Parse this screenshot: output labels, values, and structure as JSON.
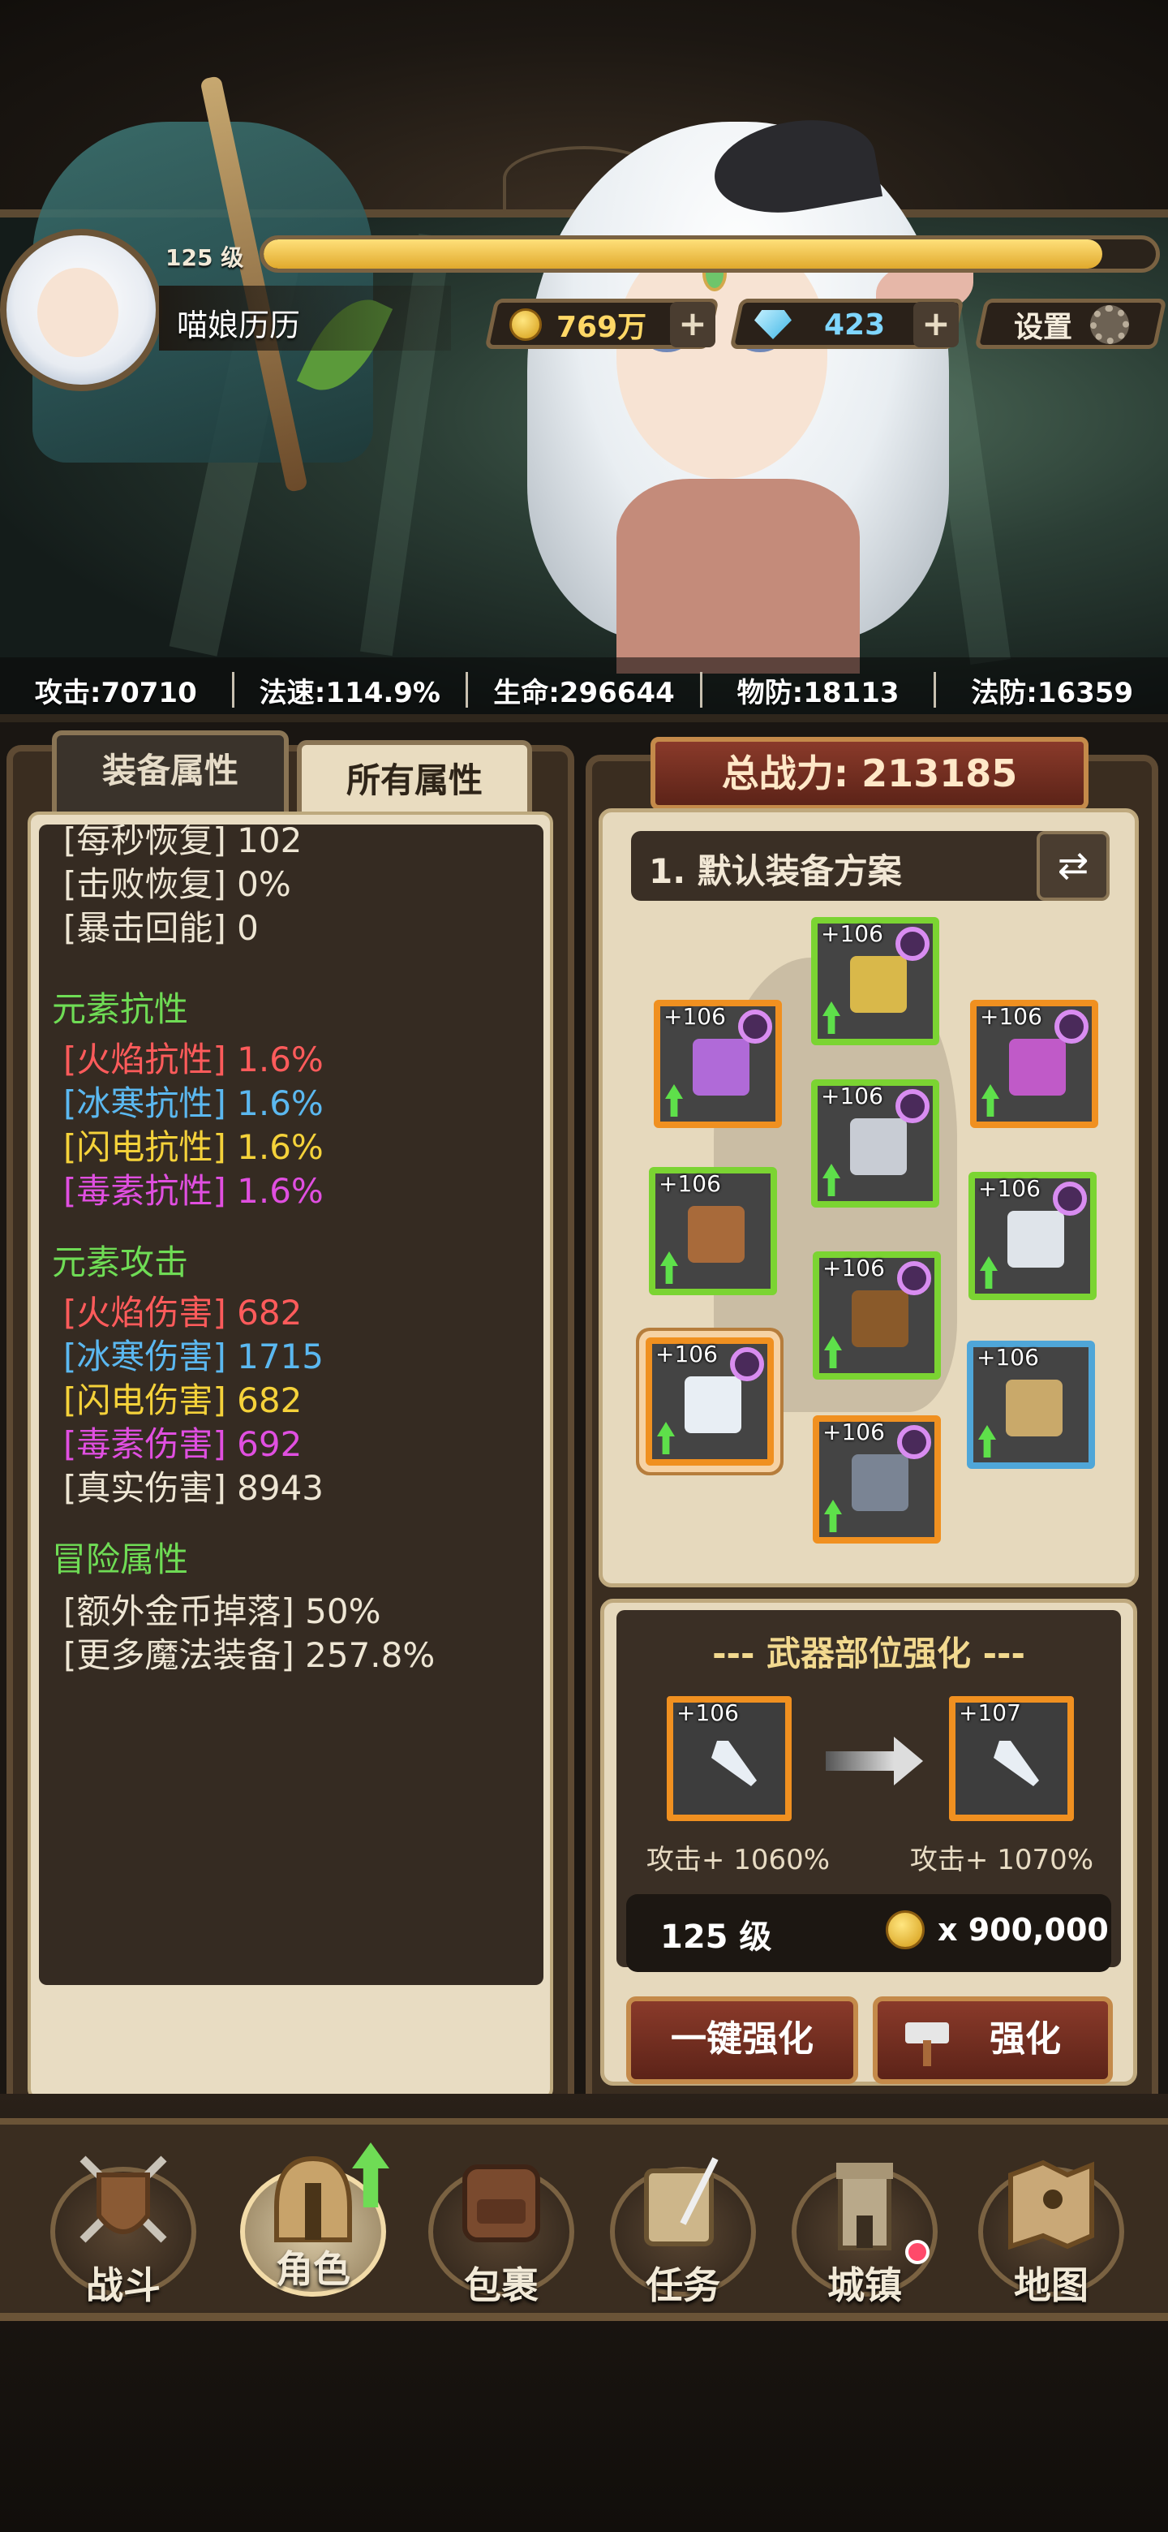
{
  "player": {
    "level_label": "125 级",
    "xp_fraction": 0.94,
    "name": "喵娘历历"
  },
  "resources": {
    "gold": "769万",
    "gems": "423",
    "settings_label": "设置",
    "plus_symbol": "+"
  },
  "stats": [
    "攻击:70710",
    "法速:114.9%",
    "生命:296644",
    "物防:18113",
    "法防:16359"
  ],
  "tabs": {
    "equipment_attrs": "装备属性",
    "all_attrs": "所有属性"
  },
  "attributes": {
    "top_lines": [
      "[每秒恢复] 102",
      "[击败恢复] 0%",
      "[暴击回能] 0"
    ],
    "elem_resist_header": "元素抗性",
    "elem_resist": [
      {
        "label": "[火焰抗性]",
        "value": "1.6%"
      },
      {
        "label": "[冰寒抗性]",
        "value": "1.6%"
      },
      {
        "label": "[闪电抗性]",
        "value": "1.6%"
      },
      {
        "label": "[毒素抗性]",
        "value": "1.6%"
      }
    ],
    "elem_attack_header": "元素攻击",
    "elem_attack": [
      {
        "label": "[火焰伤害]",
        "value": "682"
      },
      {
        "label": "[冰寒伤害]",
        "value": "1715"
      },
      {
        "label": "[闪电伤害]",
        "value": "682"
      },
      {
        "label": "[毒素伤害]",
        "value": "692"
      },
      {
        "label": "[真实伤害]",
        "value": "8943"
      }
    ],
    "adventure_header": "冒险属性",
    "adventure": [
      {
        "label": "[额外金币掉落]",
        "value": "50%"
      },
      {
        "label": "[更多魔法装备]",
        "value": "257.8%"
      }
    ]
  },
  "power": {
    "label": "总战力: 213185"
  },
  "equip_plan": {
    "title": "1. 默认装备方案",
    "swap_icon": "⇄",
    "slots": [
      {
        "name": "helmet",
        "level": "+106",
        "rarity": "green",
        "item_color": "#d9b84a"
      },
      {
        "name": "ring",
        "level": "+106",
        "rarity": "orange",
        "item_color": "#b06ad8"
      },
      {
        "name": "necklace",
        "level": "+106",
        "rarity": "orange",
        "item_color": "#c05ac8"
      },
      {
        "name": "armor",
        "level": "+106",
        "rarity": "green",
        "item_color": "#c8ccd4"
      },
      {
        "name": "belt",
        "level": "+106",
        "rarity": "green",
        "item_color": "#a86a3a"
      },
      {
        "name": "bracer",
        "level": "+106",
        "rarity": "green",
        "item_color": "#dfe4ea"
      },
      {
        "name": "pants",
        "level": "+106",
        "rarity": "green",
        "item_color": "#8a5a2a"
      },
      {
        "name": "dagger",
        "level": "+106",
        "rarity": "orange",
        "item_color": "#e8eef4"
      },
      {
        "name": "staff",
        "level": "+106",
        "rarity": "blue",
        "item_color": "#c9a96a"
      },
      {
        "name": "boots",
        "level": "+106",
        "rarity": "orange",
        "item_color": "#7a8494"
      }
    ]
  },
  "upgrade": {
    "title": "--- 武器部位强化 ---",
    "from_level": "+106",
    "to_level": "+107",
    "from_caption": "攻击+ 1060%",
    "to_caption": "攻击+ 1070%",
    "cost_level": "125 级",
    "cost_amount": "x 900,000",
    "one_click_label": "一键强化",
    "enhance_label": "强化"
  },
  "nav": [
    {
      "label": "战斗"
    },
    {
      "label": "角色"
    },
    {
      "label": "包裹"
    },
    {
      "label": "任务"
    },
    {
      "label": "城镇"
    },
    {
      "label": "地图"
    }
  ]
}
